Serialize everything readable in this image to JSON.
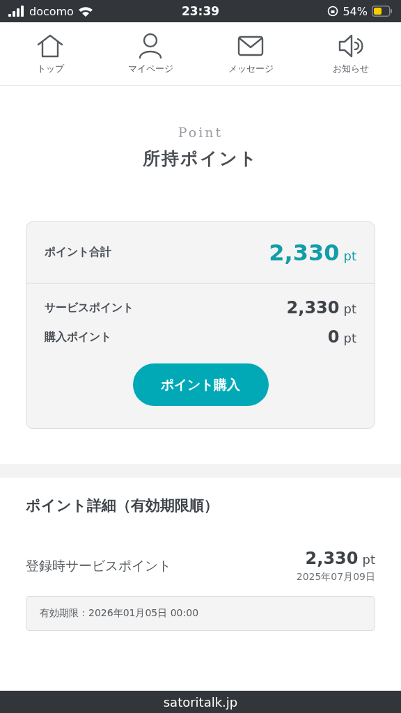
{
  "status_bar": {
    "carrier": "docomo",
    "time": "23:39",
    "battery": "54%"
  },
  "nav": [
    {
      "label": "トップ",
      "kind": "home"
    },
    {
      "label": "マイページ",
      "kind": "user"
    },
    {
      "label": "メッセージ",
      "kind": "mail"
    },
    {
      "label": "お知らせ",
      "kind": "speaker"
    }
  ],
  "heading": {
    "eyebrow": "Point",
    "title": "所持ポイント"
  },
  "summary": {
    "total": {
      "label": "ポイント合計",
      "amount": "2,330",
      "unit": "pt"
    },
    "rows": [
      {
        "label": "サービスポイント",
        "amount": "2,330",
        "unit": "pt"
      },
      {
        "label": "購入ポイント",
        "amount": "0",
        "unit": "pt"
      }
    ],
    "button": "ポイント購入"
  },
  "details": {
    "title": "ポイント詳細（有効期限順）",
    "items": [
      {
        "label": "登録時サービスポイント",
        "amount": "2,330",
        "unit": "pt",
        "date": "2025年07月09日",
        "expiry": "有効期限：2026年01月05日 00:00"
      }
    ]
  },
  "footer": "satoritalk.jp"
}
